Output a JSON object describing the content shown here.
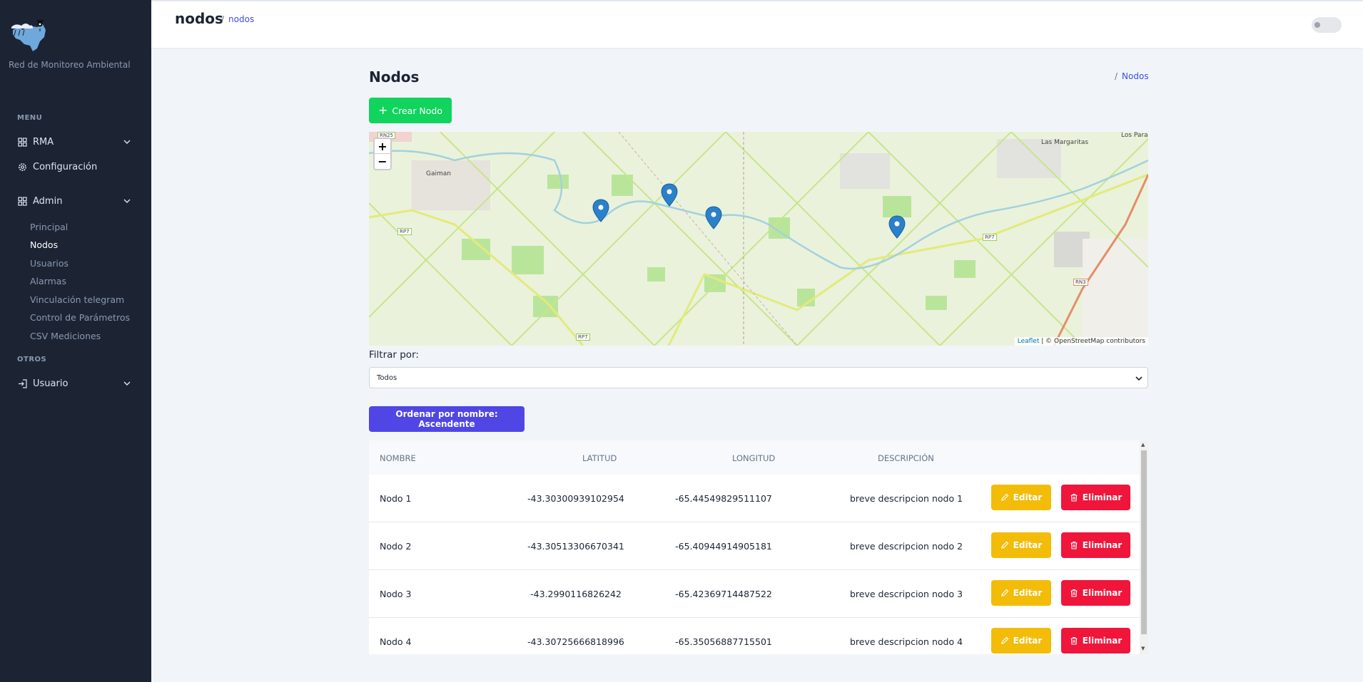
{
  "sidebar": {
    "brand": "Red de Monitoreo Ambiental",
    "menu_heading": "MENU",
    "others_heading": "OTROS",
    "items": [
      {
        "label": "RMA",
        "icon": "grid-icon"
      },
      {
        "label": "Configuración",
        "icon": "gear-icon"
      },
      {
        "label": "Admin",
        "icon": "grid-icon"
      },
      {
        "label": "Usuario",
        "icon": "login-icon"
      }
    ],
    "admin_sub": [
      {
        "label": "Principal"
      },
      {
        "label": "Nodos",
        "active": true
      },
      {
        "label": "Usuarios"
      },
      {
        "label": "Alarmas"
      },
      {
        "label": "Vinculación telegram"
      },
      {
        "label": "Control de Parámetros"
      },
      {
        "label": "CSV Mediciones"
      }
    ]
  },
  "header": {
    "title": "nodos",
    "crumb": "nodos"
  },
  "page": {
    "title": "Nodos",
    "crumb": "Nodos",
    "create_button": "Crear Nodo"
  },
  "map": {
    "zoom_in": "+",
    "zoom_out": "−",
    "attribution_leaflet": "Leaflet",
    "attribution_rest": "| © OpenStreetMap contributors",
    "labels": {
      "gaiman": "Gaiman",
      "las_margaritas": "Las Margaritas",
      "los_para": "Los Para",
      "rp7": "RP7",
      "rn3": "RN3",
      "rn25": "RN25"
    },
    "marker_count": 4
  },
  "filter": {
    "label": "Filtrar por:",
    "selected": "Todos"
  },
  "sort_button": "Ordenar por nombre: Ascendente",
  "table": {
    "columns": [
      "NOMBRE",
      "LATITUD",
      "LONGITUD",
      "DESCRIPCIÓN"
    ],
    "edit_label": "Editar",
    "delete_label": "Eliminar",
    "rows": [
      {
        "nombre": "Nodo 1",
        "latitud": "-43.30300939102954",
        "longitud": "-65.44549829511107",
        "descripcion": "breve descripcion nodo 1"
      },
      {
        "nombre": "Nodo 2",
        "latitud": "-43.30513306670341",
        "longitud": "-65.40944914905181",
        "descripcion": "breve descripcion nodo 2"
      },
      {
        "nombre": "Nodo 3",
        "latitud": "-43.2990116826242",
        "longitud": "-65.42369714487522",
        "descripcion": "breve descripcion nodo 3"
      },
      {
        "nombre": "Nodo 4",
        "latitud": "-43.30725666818996",
        "longitud": "-65.35056887715501",
        "descripcion": "breve descripcion nodo 4"
      }
    ]
  },
  "colors": {
    "sidebar": "#1c2434",
    "create": "#10d45d",
    "sort": "#4f46e5",
    "edit": "#f2bc09",
    "delete": "#f0153a",
    "link": "#3c50e0"
  }
}
